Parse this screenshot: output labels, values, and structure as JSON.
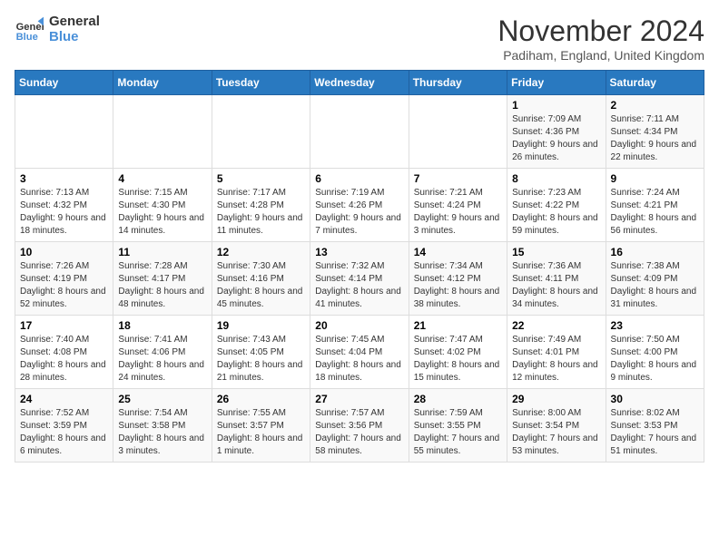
{
  "logo": {
    "line1": "General",
    "line2": "Blue"
  },
  "title": "November 2024",
  "location": "Padiham, England, United Kingdom",
  "days_of_week": [
    "Sunday",
    "Monday",
    "Tuesday",
    "Wednesday",
    "Thursday",
    "Friday",
    "Saturday"
  ],
  "weeks": [
    [
      {
        "day": "",
        "info": ""
      },
      {
        "day": "",
        "info": ""
      },
      {
        "day": "",
        "info": ""
      },
      {
        "day": "",
        "info": ""
      },
      {
        "day": "",
        "info": ""
      },
      {
        "day": "1",
        "info": "Sunrise: 7:09 AM\nSunset: 4:36 PM\nDaylight: 9 hours and 26 minutes."
      },
      {
        "day": "2",
        "info": "Sunrise: 7:11 AM\nSunset: 4:34 PM\nDaylight: 9 hours and 22 minutes."
      }
    ],
    [
      {
        "day": "3",
        "info": "Sunrise: 7:13 AM\nSunset: 4:32 PM\nDaylight: 9 hours and 18 minutes."
      },
      {
        "day": "4",
        "info": "Sunrise: 7:15 AM\nSunset: 4:30 PM\nDaylight: 9 hours and 14 minutes."
      },
      {
        "day": "5",
        "info": "Sunrise: 7:17 AM\nSunset: 4:28 PM\nDaylight: 9 hours and 11 minutes."
      },
      {
        "day": "6",
        "info": "Sunrise: 7:19 AM\nSunset: 4:26 PM\nDaylight: 9 hours and 7 minutes."
      },
      {
        "day": "7",
        "info": "Sunrise: 7:21 AM\nSunset: 4:24 PM\nDaylight: 9 hours and 3 minutes."
      },
      {
        "day": "8",
        "info": "Sunrise: 7:23 AM\nSunset: 4:22 PM\nDaylight: 8 hours and 59 minutes."
      },
      {
        "day": "9",
        "info": "Sunrise: 7:24 AM\nSunset: 4:21 PM\nDaylight: 8 hours and 56 minutes."
      }
    ],
    [
      {
        "day": "10",
        "info": "Sunrise: 7:26 AM\nSunset: 4:19 PM\nDaylight: 8 hours and 52 minutes."
      },
      {
        "day": "11",
        "info": "Sunrise: 7:28 AM\nSunset: 4:17 PM\nDaylight: 8 hours and 48 minutes."
      },
      {
        "day": "12",
        "info": "Sunrise: 7:30 AM\nSunset: 4:16 PM\nDaylight: 8 hours and 45 minutes."
      },
      {
        "day": "13",
        "info": "Sunrise: 7:32 AM\nSunset: 4:14 PM\nDaylight: 8 hours and 41 minutes."
      },
      {
        "day": "14",
        "info": "Sunrise: 7:34 AM\nSunset: 4:12 PM\nDaylight: 8 hours and 38 minutes."
      },
      {
        "day": "15",
        "info": "Sunrise: 7:36 AM\nSunset: 4:11 PM\nDaylight: 8 hours and 34 minutes."
      },
      {
        "day": "16",
        "info": "Sunrise: 7:38 AM\nSunset: 4:09 PM\nDaylight: 8 hours and 31 minutes."
      }
    ],
    [
      {
        "day": "17",
        "info": "Sunrise: 7:40 AM\nSunset: 4:08 PM\nDaylight: 8 hours and 28 minutes."
      },
      {
        "day": "18",
        "info": "Sunrise: 7:41 AM\nSunset: 4:06 PM\nDaylight: 8 hours and 24 minutes."
      },
      {
        "day": "19",
        "info": "Sunrise: 7:43 AM\nSunset: 4:05 PM\nDaylight: 8 hours and 21 minutes."
      },
      {
        "day": "20",
        "info": "Sunrise: 7:45 AM\nSunset: 4:04 PM\nDaylight: 8 hours and 18 minutes."
      },
      {
        "day": "21",
        "info": "Sunrise: 7:47 AM\nSunset: 4:02 PM\nDaylight: 8 hours and 15 minutes."
      },
      {
        "day": "22",
        "info": "Sunrise: 7:49 AM\nSunset: 4:01 PM\nDaylight: 8 hours and 12 minutes."
      },
      {
        "day": "23",
        "info": "Sunrise: 7:50 AM\nSunset: 4:00 PM\nDaylight: 8 hours and 9 minutes."
      }
    ],
    [
      {
        "day": "24",
        "info": "Sunrise: 7:52 AM\nSunset: 3:59 PM\nDaylight: 8 hours and 6 minutes."
      },
      {
        "day": "25",
        "info": "Sunrise: 7:54 AM\nSunset: 3:58 PM\nDaylight: 8 hours and 3 minutes."
      },
      {
        "day": "26",
        "info": "Sunrise: 7:55 AM\nSunset: 3:57 PM\nDaylight: 8 hours and 1 minute."
      },
      {
        "day": "27",
        "info": "Sunrise: 7:57 AM\nSunset: 3:56 PM\nDaylight: 7 hours and 58 minutes."
      },
      {
        "day": "28",
        "info": "Sunrise: 7:59 AM\nSunset: 3:55 PM\nDaylight: 7 hours and 55 minutes."
      },
      {
        "day": "29",
        "info": "Sunrise: 8:00 AM\nSunset: 3:54 PM\nDaylight: 7 hours and 53 minutes."
      },
      {
        "day": "30",
        "info": "Sunrise: 8:02 AM\nSunset: 3:53 PM\nDaylight: 7 hours and 51 minutes."
      }
    ]
  ]
}
